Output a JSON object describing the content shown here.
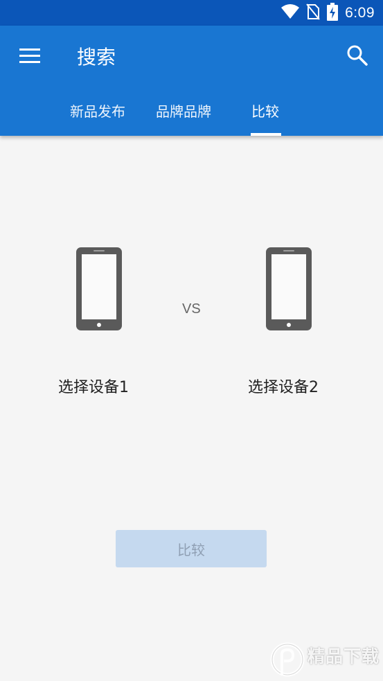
{
  "status_bar": {
    "time": "6:09",
    "icons": [
      "wifi-icon",
      "no-sim-icon",
      "battery-charging-icon"
    ]
  },
  "app_bar": {
    "menu_icon": "menu-icon",
    "title": "搜索",
    "search_icon": "search-icon"
  },
  "tabs": [
    {
      "label": "新品发布",
      "selected": false
    },
    {
      "label": "品牌品牌",
      "selected": false
    },
    {
      "label": "比较",
      "selected": true
    }
  ],
  "compare": {
    "device_icon": "smartphone-icon",
    "vs_label": "VS",
    "device1_label": "选择设备1",
    "device2_label": "选择设备2",
    "button_label": "比较",
    "button_enabled": false
  },
  "watermark": {
    "text": "精品下载"
  },
  "colors": {
    "primary": "#1976d2",
    "status_bar": "#0b56b8",
    "background": "#f5f5f5",
    "button_disabled": "#c5d9ef"
  }
}
